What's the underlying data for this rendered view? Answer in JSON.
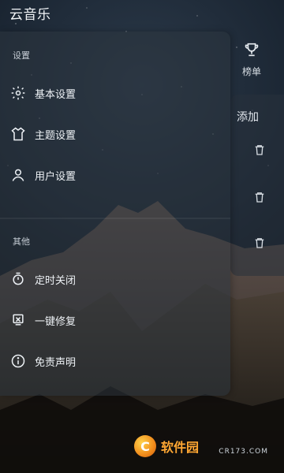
{
  "app": {
    "title": "云音乐"
  },
  "right_tab": {
    "label": "榜单",
    "icon": "trophy-icon"
  },
  "right_panel": {
    "add_label": "添加",
    "trash_count": 3
  },
  "drawer": {
    "sections": [
      {
        "title": "设置",
        "items": [
          {
            "label": "基本设置",
            "icon": "gear-icon"
          },
          {
            "label": "主题设置",
            "icon": "shirt-icon"
          },
          {
            "label": "用户设置",
            "icon": "user-icon"
          }
        ]
      },
      {
        "title": "其他",
        "items": [
          {
            "label": "定时关闭",
            "icon": "timer-icon"
          },
          {
            "label": "一键修复",
            "icon": "repair-icon"
          },
          {
            "label": "免责声明",
            "icon": "info-icon"
          }
        ]
      }
    ]
  },
  "watermark": {
    "text": "软件园",
    "site": "CR173.COM",
    "logo_letter": "C"
  },
  "colors": {
    "drawer_bg": "#2c343e",
    "accent_orange": "#ffa733"
  }
}
